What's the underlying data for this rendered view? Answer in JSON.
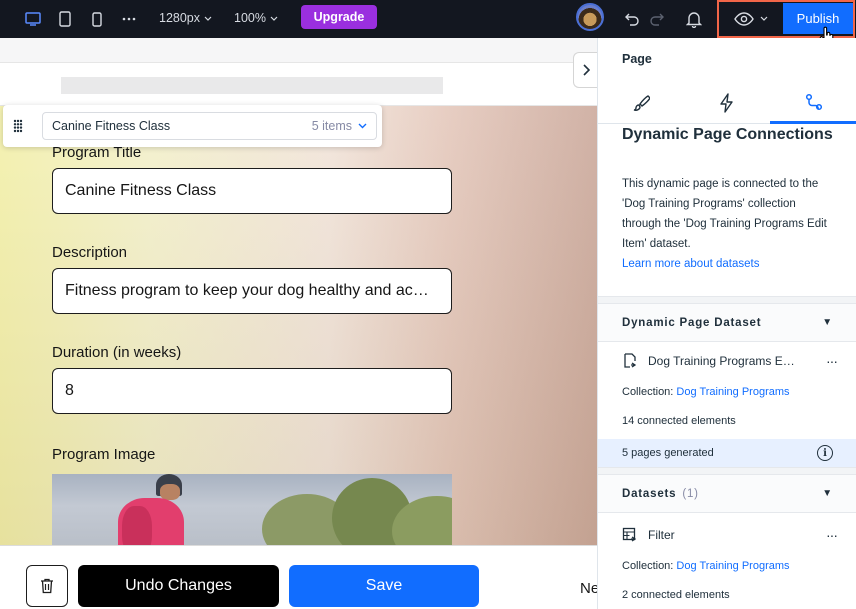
{
  "topbar": {
    "width_value": "1280px",
    "zoom_value": "100%",
    "upgrade_label": "Upgrade",
    "publish_label": "Publish"
  },
  "canvas": {
    "dataset_select": {
      "value": "Canine Fitness Class",
      "count": "5 items"
    },
    "fields": [
      {
        "label": "Program Title",
        "value": "Canine Fitness Class"
      },
      {
        "label": "Description",
        "value": "Fitness program to keep your dog healthy and ac…"
      },
      {
        "label": "Duration (in weeks)",
        "value": "8"
      },
      {
        "label": "Program Image"
      }
    ],
    "undo_label": "Undo Changes",
    "save_label": "Save",
    "next_label": "Ne"
  },
  "panel": {
    "title": "Page",
    "heading": "Dynamic Page Connections",
    "description": {
      "part1": "This dynamic page is connected to the '",
      "collection": "Dog Training Programs",
      "part2": "' collection through the '",
      "dataset": "Dog Training Programs Edit Item",
      "part3": "' dataset.",
      "link": "Learn more about datasets"
    },
    "dynamic_dataset": {
      "header": "Dynamic Page Dataset",
      "name": "Dog Training Programs E…",
      "collection_label": "Collection:",
      "collection_value": "Dog Training Programs",
      "connected": "14 connected elements",
      "pages_generated": "5 pages generated"
    },
    "datasets": {
      "header": "Datasets",
      "count": "(1)",
      "name": "Filter",
      "collection_label": "Collection:",
      "collection_value": "Dog Training Programs",
      "connected": "2 connected elements"
    }
  },
  "colors": {
    "accent": "#116dff",
    "upgrade": "#9a2fdf",
    "topbar": "#131720",
    "highlight": "#f26649"
  }
}
